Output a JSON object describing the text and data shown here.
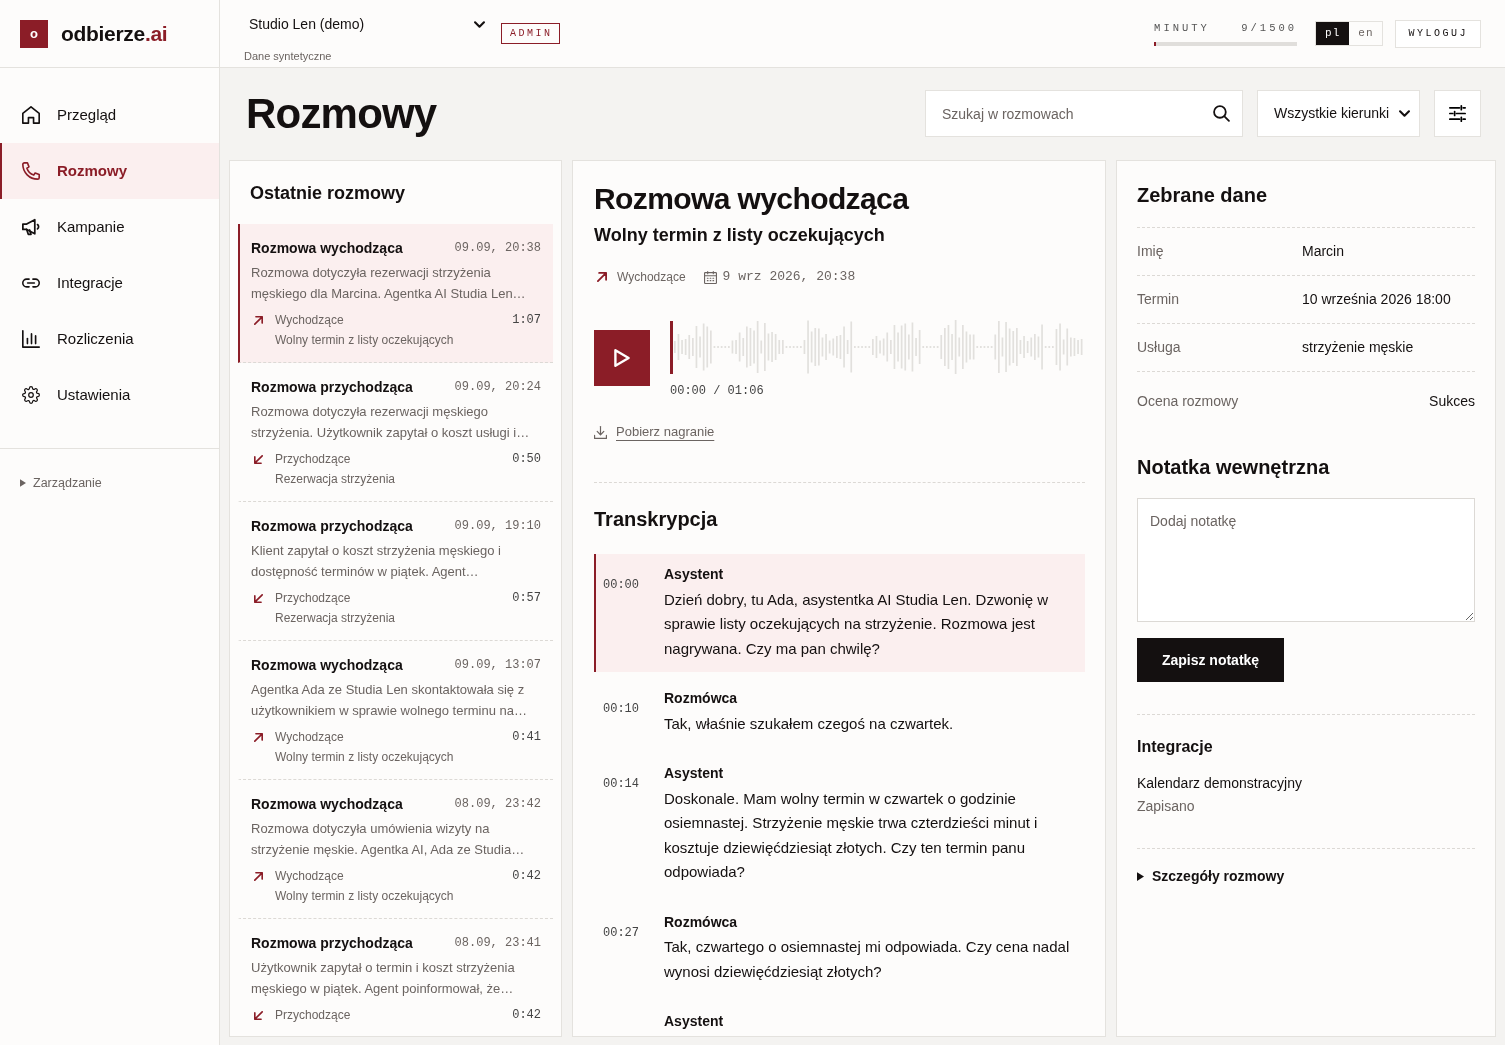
{
  "brand": {
    "mark": "o",
    "name": "odbierze",
    "suffix": ".ai"
  },
  "header": {
    "studio": "Studio Len (demo)",
    "studio_note": "Dane syntetyczne",
    "role_badge": "ADMIN",
    "usage": {
      "label": "MINUTY",
      "reading": "9/1500",
      "level": 0.006
    },
    "languages": [
      {
        "label": "pl",
        "selected": true
      },
      {
        "label": "en",
        "selected": false
      }
    ],
    "logout": "WYLOGUJ"
  },
  "sidebar": {
    "items": [
      {
        "label": "Przegląd",
        "selected": false
      },
      {
        "label": "Rozmowy",
        "selected": true
      },
      {
        "label": "Kampanie",
        "selected": false
      },
      {
        "label": "Integracje",
        "selected": false
      },
      {
        "label": "Rozliczenia",
        "selected": false
      },
      {
        "label": "Ustawienia",
        "selected": false
      }
    ],
    "section": {
      "label": "Zarządzanie",
      "expanded": false
    }
  },
  "page": {
    "title": "Rozmowy",
    "search": {
      "placeholder": "Szukaj w rozmowach"
    },
    "direction_filter": {
      "value": "Wszystkie kierunki"
    }
  },
  "recent_calls": {
    "title": "Ostatnie rozmowy",
    "items": [
      {
        "title": "Rozmowa wychodząca",
        "time": "09.09, 20:38",
        "summary": "Rozmowa dotyczyła rezerwacji strzyżenia męskiego dla Marcina. Agentka AI Studia Len…",
        "kind": "outgoing",
        "direction": "Wychodzące",
        "duration": "1:07",
        "campaign": "Wolny termin z listy oczekujących",
        "selected": true
      },
      {
        "title": "Rozmowa przychodząca",
        "time": "09.09, 20:24",
        "summary": "Rozmowa dotyczyła rezerwacji męskiego strzyżenia. Użytkownik zapytał o koszt usługi i…",
        "kind": "incoming",
        "direction": "Przychodzące",
        "duration": "0:50",
        "campaign": "Rezerwacja strzyżenia",
        "selected": false
      },
      {
        "title": "Rozmowa przychodząca",
        "time": "09.09, 19:10",
        "summary": "Klient zapytał o koszt strzyżenia męskiego i dostępność terminów w piątek. Agent…",
        "kind": "incoming",
        "direction": "Przychodzące",
        "duration": "0:57",
        "campaign": "Rezerwacja strzyżenia",
        "selected": false
      },
      {
        "title": "Rozmowa wychodząca",
        "time": "09.09, 13:07",
        "summary": "Agentka Ada ze Studia Len skontaktowała się z użytkownikiem w sprawie wolnego terminu na…",
        "kind": "outgoing",
        "direction": "Wychodzące",
        "duration": "0:41",
        "campaign": "Wolny termin z listy oczekujących",
        "selected": false
      },
      {
        "title": "Rozmowa wychodząca",
        "time": "08.09, 23:42",
        "summary": "Rozmowa dotyczyła umówienia wizyty na strzyżenie męskie. Agentka AI, Ada ze Studia…",
        "kind": "outgoing",
        "direction": "Wychodzące",
        "duration": "0:42",
        "campaign": "Wolny termin z listy oczekujących",
        "selected": false
      },
      {
        "title": "Rozmowa przychodząca",
        "time": "08.09, 23:41",
        "summary": "Użytkownik zapytał o termin i koszt strzyżenia męskiego w piątek. Agent poinformował, że…",
        "kind": "incoming",
        "direction": "Przychodzące",
        "duration": "0:42",
        "selected": false
      }
    ]
  },
  "call": {
    "title": "Rozmowa wychodząca",
    "subtitle": "Wolny termin z listy oczekujących",
    "kind": "outgoing",
    "direction": "Wychodzące",
    "date": "9 wrz 2026, 20:38",
    "player": {
      "level": 0,
      "time": "00:00 / 01:06"
    },
    "download": "Pobierz nagranie",
    "transcript_title": "Transkrypcja",
    "transcript": [
      {
        "time": "00:00",
        "speaker": "Asystent",
        "text": "Dzień dobry, tu Ada, asystentka AI Studia Len. Dzwonię w sprawie listy oczekujących na strzyżenie. Rozmowa jest nagrywana. Czy ma pan chwilę?",
        "selected": true
      },
      {
        "time": "00:10",
        "speaker": "Rozmówca",
        "text": "Tak, właśnie szukałem czegoś na czwartek.",
        "selected": false
      },
      {
        "time": "00:14",
        "speaker": "Asystent",
        "text": "Doskonale. Mam wolny termin w czwartek o godzinie osiemnastej. Strzyżenie męskie trwa czterdzieści minut i kosztuje dziewięćdziesiąt złotych. Czy ten termin panu odpowiada?",
        "selected": false
      },
      {
        "time": "00:27",
        "speaker": "Rozmówca",
        "text": "Tak, czwartego o osiemnastej mi odpowiada. Czy cena nadal wynosi dziewięćdziesiąt złotych?",
        "selected": false
      },
      {
        "speaker": "Asystent",
        "selected": false
      }
    ]
  },
  "details": {
    "title": "Zebrane dane",
    "fields": [
      {
        "label": "Imię",
        "value": "Marcin"
      },
      {
        "label": "Termin",
        "value": "10 września 2026 18:00"
      },
      {
        "label": "Usługa",
        "value": "strzyżenie męskie"
      }
    ],
    "rating": {
      "label": "Ocena rozmowy",
      "value": "Sukces"
    },
    "note": {
      "title": "Notatka wewnętrzna",
      "placeholder": "Dodaj notatkę",
      "button": "Zapisz notatkę"
    },
    "integrations": {
      "title": "Integracje",
      "items": [
        {
          "name": "Kalendarz demonstracyjny",
          "status": "Zapisano"
        }
      ]
    },
    "more": {
      "label": "Szczegóły rozmowy",
      "expanded": false
    }
  }
}
